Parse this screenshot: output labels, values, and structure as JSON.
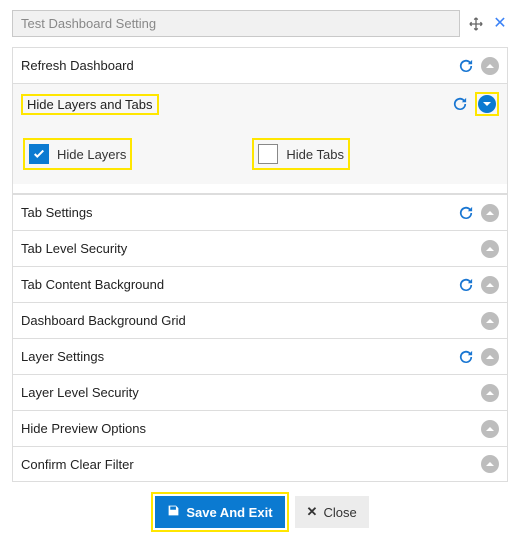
{
  "header": {
    "title": "Test Dashboard Setting"
  },
  "sections": [
    {
      "label": "Refresh Dashboard",
      "has_refresh": true,
      "expanded": false,
      "highlighted": false
    },
    {
      "label": "Hide Layers and Tabs",
      "has_refresh": true,
      "expanded": true,
      "highlighted": true,
      "options": [
        {
          "label": "Hide Layers",
          "checked": true
        },
        {
          "label": "Hide Tabs",
          "checked": false
        }
      ]
    },
    {
      "label": "Tab Settings",
      "has_refresh": true,
      "expanded": false,
      "highlighted": false
    },
    {
      "label": "Tab Level Security",
      "has_refresh": false,
      "expanded": false,
      "highlighted": false
    },
    {
      "label": "Tab Content Background",
      "has_refresh": true,
      "expanded": false,
      "highlighted": false
    },
    {
      "label": "Dashboard Background Grid",
      "has_refresh": false,
      "expanded": false,
      "highlighted": false
    },
    {
      "label": "Layer Settings",
      "has_refresh": true,
      "expanded": false,
      "highlighted": false
    },
    {
      "label": "Layer Level Security",
      "has_refresh": false,
      "expanded": false,
      "highlighted": false
    },
    {
      "label": "Hide Preview Options",
      "has_refresh": false,
      "expanded": false,
      "highlighted": false
    },
    {
      "label": "Confirm Clear Filter",
      "has_refresh": false,
      "expanded": false,
      "highlighted": false
    }
  ],
  "footer": {
    "save_label": "Save And Exit",
    "close_label": "Close"
  }
}
